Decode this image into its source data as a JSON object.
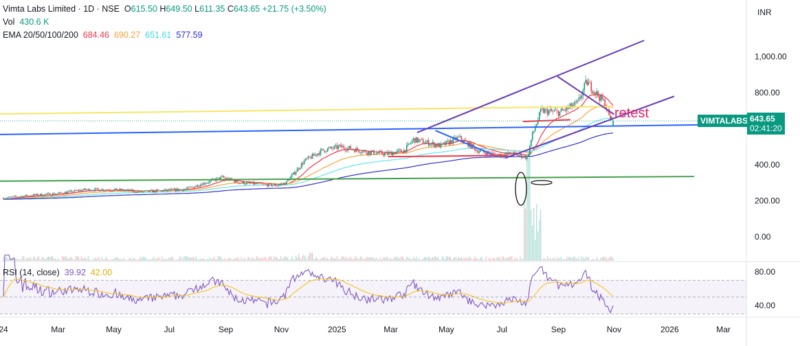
{
  "header": {
    "symbol": "Vimta Labs Limited",
    "interval": "1D",
    "exchange": "NSE",
    "open": "615.50",
    "high": "649.50",
    "low": "611.35",
    "close": "643.65",
    "change": "+21.75 (+3.50%)",
    "vol_label": "Vol",
    "vol_value": "430.6 K",
    "ema_label": "EMA 20/50/100/200",
    "ema20": "684.46",
    "ema50": "690.27",
    "ema100": "651.61",
    "ema200": "577.59",
    "currency": "INR"
  },
  "price_tag": {
    "ticker": "VIMTALABS",
    "price": "643.65",
    "countdown": "02:41:20"
  },
  "rsi": {
    "label": "RSI (14, close)",
    "value": "39.92",
    "ma": "42.00"
  },
  "colors": {
    "up": "#089981",
    "down": "#f23645",
    "ema20": "#f23645",
    "ema50": "#f7a23b",
    "ema100": "#5ee6f0",
    "ema200": "#3030d0",
    "rsi": "#7e57c2",
    "rsi_ma": "#f5c518"
  },
  "chart_data": {
    "type": "candlestick",
    "x_unit": "days since 2024-01-01",
    "price_axis": {
      "ticks": [
        "1,000.00",
        "800.00",
        "400.00",
        "200.00",
        "0.00"
      ],
      "tick_values": [
        1000,
        800,
        400,
        200,
        0
      ],
      "ylim": [
        -130,
        1310
      ]
    },
    "rsi_axis": {
      "ticks": [
        "80.00",
        "40.00"
      ],
      "tick_values": [
        80,
        40
      ],
      "bands": [
        30,
        70
      ]
    },
    "time_axis": {
      "labels": [
        "24",
        "Mar",
        "May",
        "Jul",
        "Sep",
        "Nov",
        "2025",
        "Mar",
        "May",
        "Jul",
        "Sep",
        "Nov",
        "2026",
        "Mar"
      ],
      "days": [
        0,
        60,
        121,
        182,
        244,
        305,
        366,
        425,
        486,
        547,
        609,
        670,
        731,
        790
      ]
    },
    "close_anchors": [
      [
        0,
        215
      ],
      [
        30,
        230
      ],
      [
        60,
        240
      ],
      [
        90,
        262
      ],
      [
        120,
        262
      ],
      [
        150,
        250
      ],
      [
        180,
        258
      ],
      [
        200,
        265
      ],
      [
        240,
        330
      ],
      [
        260,
        300
      ],
      [
        300,
        285
      ],
      [
        310,
        300
      ],
      [
        330,
        420
      ],
      [
        350,
        480
      ],
      [
        370,
        500
      ],
      [
        400,
        470
      ],
      [
        420,
        460
      ],
      [
        440,
        480
      ],
      [
        450,
        540
      ],
      [
        480,
        505
      ],
      [
        500,
        550
      ],
      [
        520,
        480
      ],
      [
        540,
        455
      ],
      [
        560,
        460
      ],
      [
        575,
        440
      ],
      [
        580,
        560
      ],
      [
        590,
        700
      ],
      [
        610,
        690
      ],
      [
        630,
        740
      ],
      [
        640,
        860
      ],
      [
        650,
        800
      ],
      [
        660,
        740
      ],
      [
        665,
        660
      ],
      [
        670,
        644
      ]
    ],
    "drawings": [
      {
        "type": "line",
        "color": "#f5e663",
        "points": [
          [
            -4,
            682
          ],
          [
            668,
            724
          ]
        ]
      },
      {
        "type": "line",
        "color": "#2962ff",
        "points": [
          [
            -4,
            568
          ],
          [
            815,
            625
          ]
        ]
      },
      {
        "type": "line",
        "color": "#43a047",
        "points": [
          [
            -4,
            309
          ],
          [
            758,
            335
          ]
        ]
      },
      {
        "type": "line",
        "color": "#673ab7",
        "points": [
          [
            454,
            579
          ],
          [
            703,
            1090
          ]
        ]
      },
      {
        "type": "line",
        "color": "#673ab7",
        "points": [
          [
            551,
            438
          ],
          [
            736,
            780
          ]
        ]
      },
      {
        "type": "line",
        "color": "#673ab7",
        "points": [
          [
            608,
            890
          ],
          [
            670,
            680
          ]
        ]
      },
      {
        "type": "line",
        "color": "#2962ff",
        "points": [
          [
            474,
            590
          ],
          [
            540,
            450
          ]
        ]
      },
      {
        "type": "line",
        "color": "#f23645",
        "points": [
          [
            422,
            445
          ],
          [
            554,
            452
          ]
        ]
      },
      {
        "type": "line",
        "color": "#f23645",
        "points": [
          [
            570,
            640
          ],
          [
            622,
            650
          ]
        ]
      }
    ],
    "annotation": "retest"
  }
}
